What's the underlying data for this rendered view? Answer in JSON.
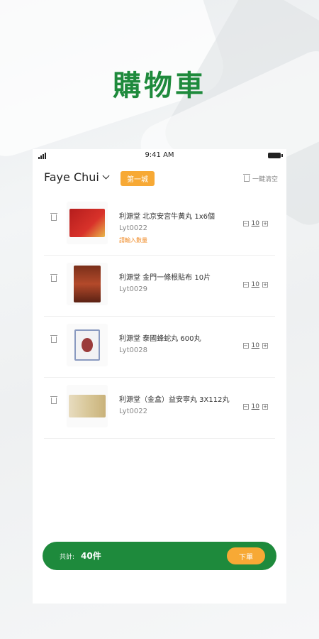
{
  "hero": {
    "title": "購物車"
  },
  "status_bar": {
    "time": "9:41 AM"
  },
  "header": {
    "user_name": "Faye Chui",
    "city_badge": "第一城",
    "clear_label": "一鍵清空"
  },
  "cart": {
    "items": [
      {
        "name": "利源堂 北京安宮牛黃丸 1x6個",
        "code": "Lyt0022",
        "note": "請輸入數量",
        "qty": "10"
      },
      {
        "name": "利源堂 金門一條根貼布  10片",
        "code": "Lyt0029",
        "note": "",
        "qty": "10"
      },
      {
        "name": "利源堂 泰國蜂蛇丸  600丸",
        "code": "Lyt0028",
        "note": "",
        "qty": "10"
      },
      {
        "name": "利源堂（金盒）益安寧丸 3X112丸",
        "code": "Lyt0022",
        "note": "",
        "qty": "10"
      }
    ]
  },
  "footer": {
    "total_label": "共計:",
    "total_value": "40件",
    "order_label": "下單"
  },
  "colors": {
    "brand_green": "#1e8a3c",
    "accent_orange": "#f7a935"
  },
  "icons": [
    "signal-icon",
    "battery-icon",
    "chevron-down-icon",
    "trash-icon",
    "minus-icon",
    "plus-icon"
  ]
}
